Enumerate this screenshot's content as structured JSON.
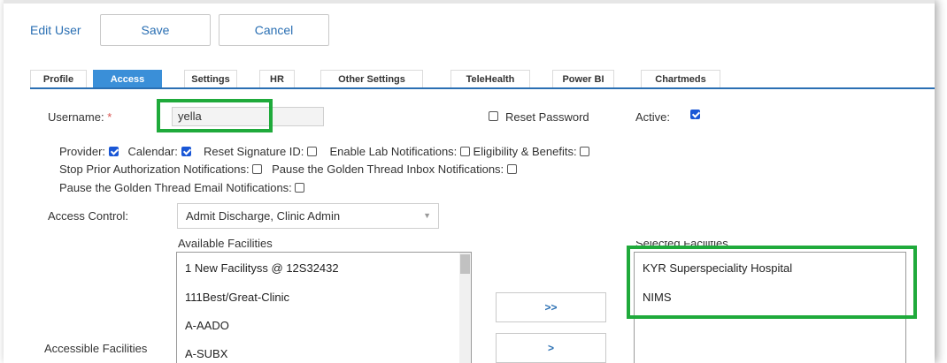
{
  "header": {
    "title": "Edit User",
    "save_label": "Save",
    "cancel_label": "Cancel"
  },
  "tabs": [
    {
      "label": "Profile",
      "active": false
    },
    {
      "label": "Access",
      "active": true
    },
    {
      "label": "Settings",
      "active": false
    },
    {
      "label": "HR",
      "active": false
    },
    {
      "label": "Other Settings",
      "active": false
    },
    {
      "label": "TeleHealth",
      "active": false
    },
    {
      "label": "Power BI",
      "active": false
    },
    {
      "label": "Chartmeds",
      "active": false
    }
  ],
  "form": {
    "username_label": "Username:",
    "required_mark": "*",
    "username_value": "yella",
    "reset_password_label": "Reset Password",
    "reset_password_checked": false,
    "active_label": "Active:",
    "active_checked": true,
    "provider_label": "Provider:",
    "provider_checked": true,
    "calendar_label": "Calendar:",
    "calendar_checked": true,
    "reset_signature_label": "Reset Signature ID:",
    "reset_signature_checked": false,
    "lab_notifications_label": "Enable Lab Notifications:",
    "lab_notifications_checked": false,
    "eligibility_label": "Eligibility & Benefits:",
    "eligibility_checked": false,
    "stop_prior_auth_label": "Stop Prior Authorization Notifications:",
    "stop_prior_auth_checked": false,
    "pause_inbox_label": "Pause the Golden Thread Inbox Notifications:",
    "pause_inbox_checked": false,
    "pause_email_label": "Pause the Golden Thread Email Notifications:",
    "pause_email_checked": false,
    "access_control_label": "Access Control:",
    "access_control_value": "Admit Discharge, Clinic Admin",
    "accessible_facilities_label": "Accessible Facilities"
  },
  "facilities": {
    "available_label": "Available Facilities",
    "available": [
      "1 New Facilityss @ 12S32432",
      "111Best/Great-Clinic",
      "A-AADO",
      "A-SUBX"
    ],
    "selected_label": "Selected Facilities",
    "selected": [
      "KYR Superspeciality Hospital",
      "NIMS"
    ],
    "add_all_label": ">>",
    "add_label": ">"
  },
  "colors": {
    "accent": "#2a6fb3",
    "active_tab": "#3a8fd8",
    "highlight": "#1faa3b",
    "required": "#d9534f"
  }
}
